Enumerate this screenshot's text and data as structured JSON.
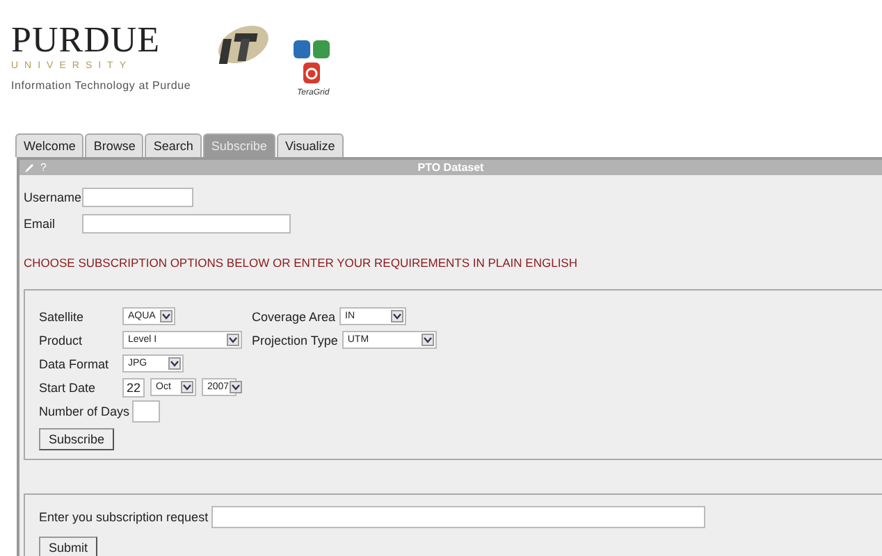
{
  "header": {
    "title": "PURDUE",
    "subtitle": "UNIVERSITY",
    "tagline": "Information Technology at Purdue",
    "partner": "TeraGrid"
  },
  "tabs": [
    {
      "label": "Welcome",
      "selected": false
    },
    {
      "label": "Browse",
      "selected": false
    },
    {
      "label": "Search",
      "selected": false
    },
    {
      "label": "Subscribe",
      "selected": true
    },
    {
      "label": "Visualize",
      "selected": false
    }
  ],
  "panel": {
    "help": "?",
    "title": "PTO Dataset"
  },
  "account_fields": [
    {
      "label": "Username"
    },
    {
      "label": "Email"
    }
  ],
  "notice": "CHOOSE SUBSCRIPTION OPTIONS BELOW OR ENTER YOUR REQUIREMENTS IN PLAIN ENGLISH",
  "options": [
    [
      {
        "label": "Satellite",
        "kind": "select",
        "value": "AQUA"
      },
      {
        "label": "Coverage Area",
        "kind": "select",
        "value": "IN"
      }
    ],
    [
      {
        "label": "Product",
        "kind": "select",
        "value": "Level I"
      },
      {
        "label": "Projection Type",
        "kind": "select",
        "value": "UTM"
      }
    ],
    [
      {
        "label": "Data Format",
        "kind": "select",
        "value": "JPG"
      }
    ],
    [
      {
        "label": "Start Date",
        "kind": "date",
        "day": "22",
        "month": "Oct",
        "year": "2007"
      }
    ],
    [
      {
        "label": "Number of Days",
        "kind": "text"
      }
    ]
  ],
  "subscribe_button": "Subscribe",
  "request": {
    "label": "Enter you subscription request",
    "button": "Submit"
  }
}
